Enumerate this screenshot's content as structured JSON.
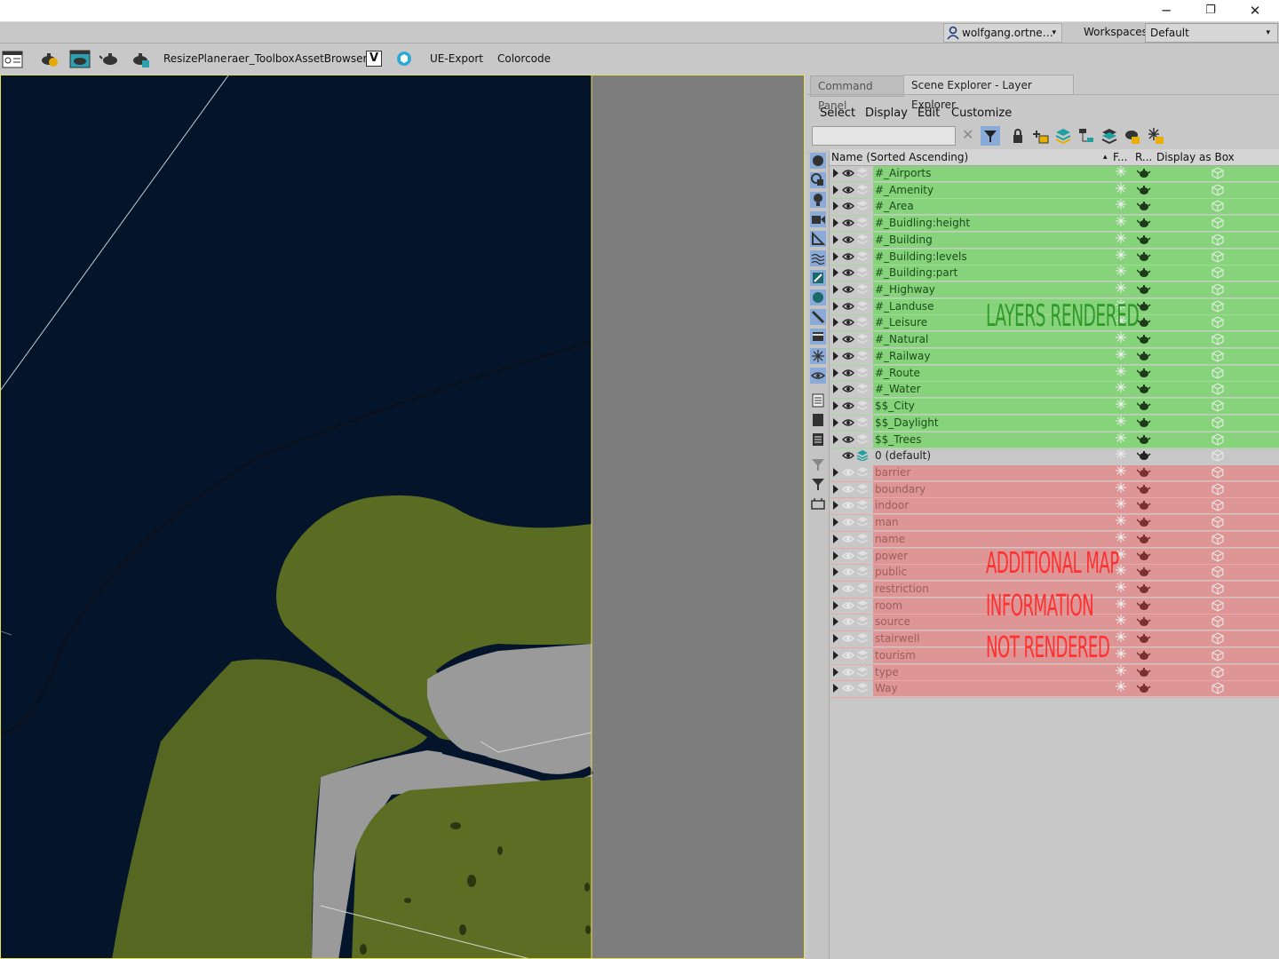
{
  "window": {
    "minimize": "─",
    "restore": "❐",
    "close": "✕"
  },
  "account": {
    "user": "wolfgang.ortne…",
    "dropdown": "▾",
    "workspaces_label": "Workspaces:",
    "workspace_value": "Default",
    "workspace_arrow": "▾"
  },
  "toolbar": {
    "icons": [
      "workspace-icon",
      "render-setup-icon",
      "rendered-frame-icon",
      "render-teapot-icon",
      "render-active-icon"
    ],
    "labels": [
      "ResizePlane",
      "raer_Toolbox",
      "AssetBrowser",
      "UE-Export",
      "Colorcode"
    ],
    "v_icon": "V"
  },
  "panel": {
    "tabs": [
      "Command Panel",
      "Scene Explorer - Layer Explorer"
    ],
    "menus": [
      "Select",
      "Display",
      "Edit",
      "Customize"
    ],
    "search_clear": "✕",
    "columns": {
      "name": "Name (Sorted Ascending)",
      "sort": "▴",
      "frozen": "F...",
      "render": "R...",
      "display_box": "Display as Box"
    }
  },
  "layers_rendered": [
    "#_Airports",
    "#_Amenity",
    "#_Area",
    "#_Buidling:height",
    "#_Building",
    "#_Building:levels",
    "#_Building:part",
    "#_Highway",
    "#_Landuse",
    "#_Leisure",
    "#_Natural",
    "#_Railway",
    "#_Route",
    "#_Water",
    "$$_City",
    "$$_Daylight",
    "$$_Trees"
  ],
  "default_layer": "0 (default)",
  "layers_not_rendered": [
    "barrier",
    "boundary",
    "indoor",
    "man",
    "name",
    "power",
    "public",
    "restriction",
    "room",
    "source",
    "stairwell",
    "tourism",
    "type",
    "Way"
  ],
  "annotations": {
    "green": "LAYERS RENDERED",
    "red_lines": [
      "ADDITIONAL MAP",
      "INFORMATION",
      "NOT RENDERED"
    ]
  },
  "colors": {
    "green_row": "#87d37c",
    "red_row": "#dd9595",
    "green_text": "#2f9a2a",
    "red_text": "#ff3030",
    "viewport_bg": "#03142b",
    "terrain": "#5a6b22",
    "road": "#9a9a9a"
  }
}
